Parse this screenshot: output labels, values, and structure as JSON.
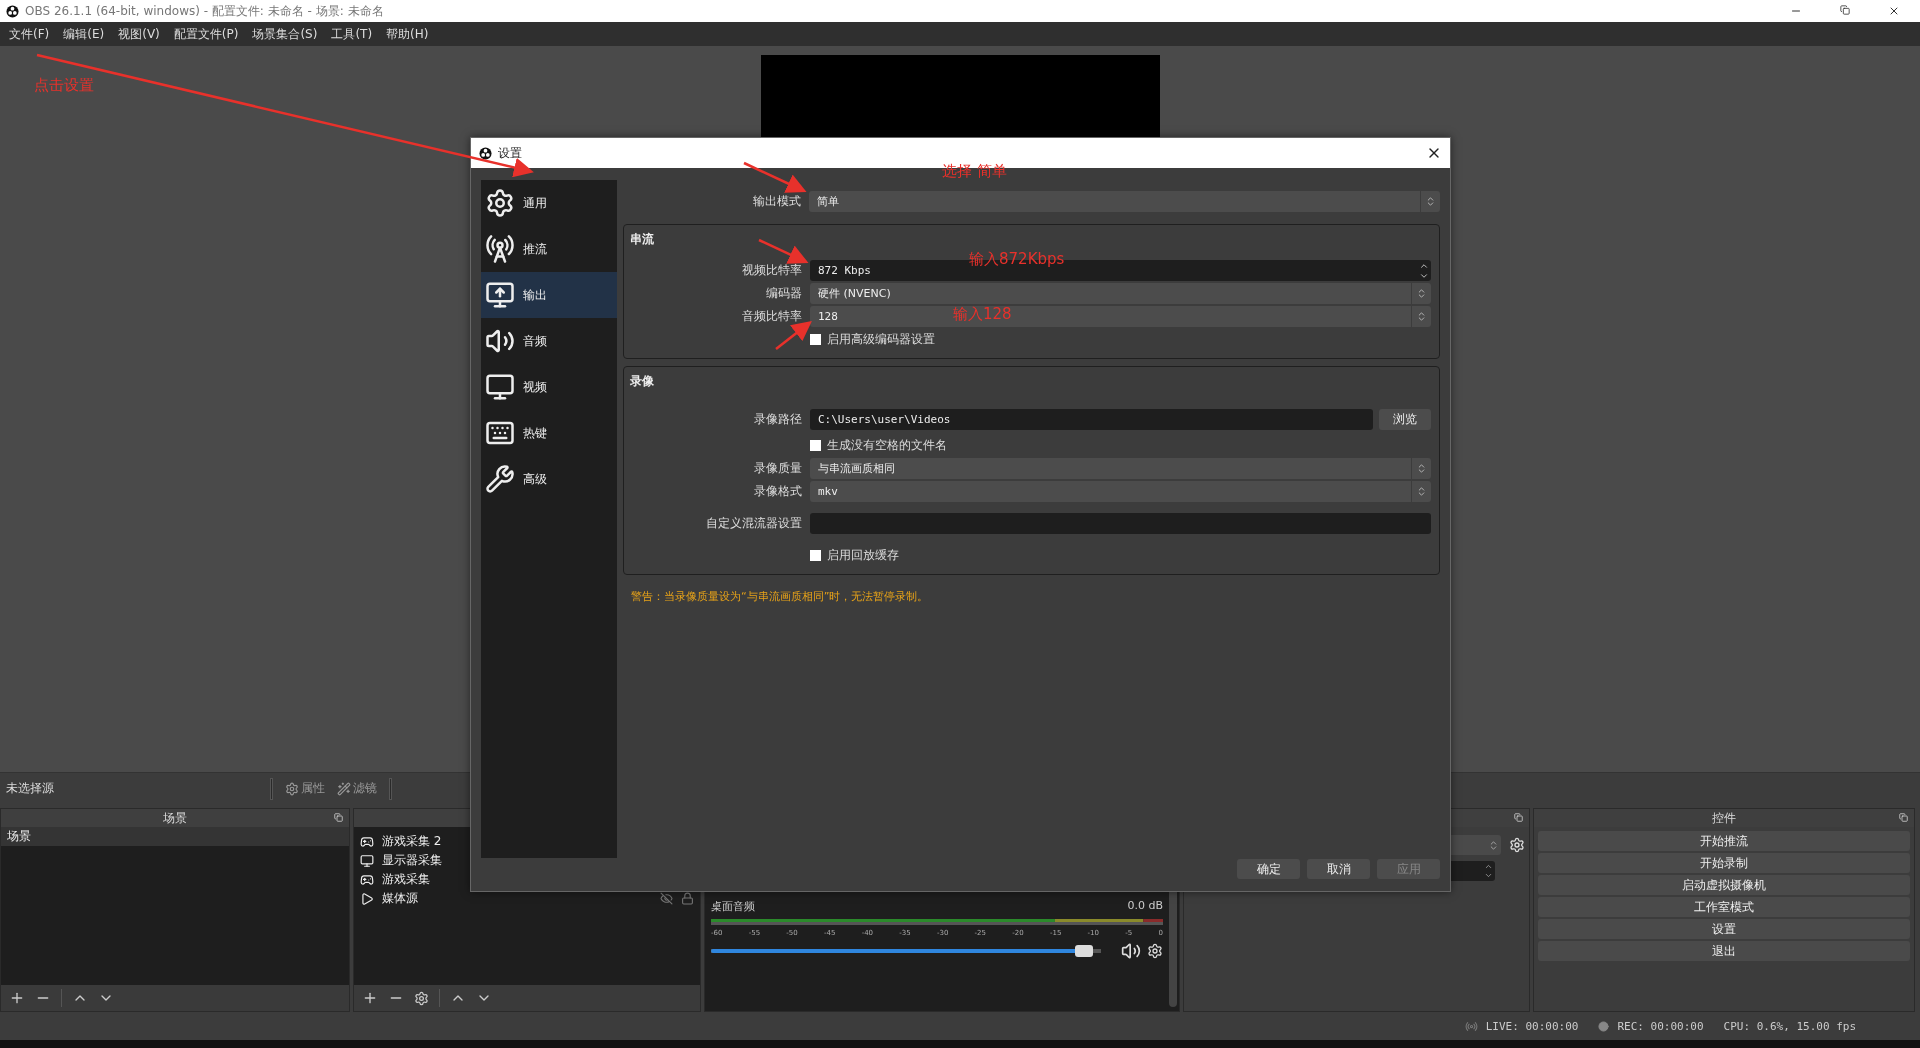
{
  "window": {
    "title": "OBS 26.1.1 (64-bit, windows) - 配置文件: 未命名 - 场景: 未命名"
  },
  "menu": [
    "文件(F)",
    "编辑(E)",
    "视图(V)",
    "配置文件(P)",
    "场景集合(S)",
    "工具(T)",
    "帮助(H)"
  ],
  "source_toolbar": {
    "label": "未选择源",
    "buttons": [
      "属性",
      "滤镜"
    ]
  },
  "scenes": {
    "title": "场景",
    "items": [
      {
        "label": "场景",
        "selected": true
      }
    ]
  },
  "sources": {
    "items": [
      {
        "label": "游戏采集 2",
        "kind": "game"
      },
      {
        "label": "显示器采集",
        "kind": "display"
      },
      {
        "label": "游戏采集",
        "kind": "game"
      },
      {
        "label": "媒体源",
        "kind": "media",
        "hovered": true
      }
    ]
  },
  "mixer": {
    "ticks": [
      "-60",
      "-55",
      "-50",
      "-45",
      "-40",
      "-35",
      "-30",
      "-25",
      "-20",
      "-15",
      "-10",
      "-5",
      "0"
    ],
    "channels": [
      {
        "name": "桌面音频",
        "reading": "0.0 dB",
        "level": 0.98,
        "muted": false
      }
    ]
  },
  "controls": {
    "title": "控件",
    "buttons": [
      "开始推流",
      "开始录制",
      "启动虚拟摄像机",
      "工作室模式",
      "设置",
      "退出"
    ]
  },
  "status_bar": {
    "live": "LIVE: 00:00:00",
    "rec": "REC: 00:00:00",
    "cpu": "CPU: 0.6%, 15.00 fps"
  },
  "settings_dialog": {
    "title": "设置",
    "sidebar": [
      {
        "label": "通用",
        "selected": false
      },
      {
        "label": "推流",
        "selected": false
      },
      {
        "label": "输出",
        "selected": true
      },
      {
        "label": "音频",
        "selected": false
      },
      {
        "label": "视频",
        "selected": false
      },
      {
        "label": "热键",
        "selected": false
      },
      {
        "label": "高级",
        "selected": false
      }
    ],
    "output_mode": {
      "label": "输出模式",
      "value": "简单"
    },
    "groups": [
      {
        "title": "串流",
        "fields": [
          {
            "kind": "spin",
            "label": "视频比特率",
            "value": "872 Kbps"
          },
          {
            "kind": "select",
            "label": "编码器",
            "value": "硬件 (NVENC)"
          },
          {
            "kind": "select",
            "label": "音频比特率",
            "value": "128"
          },
          {
            "kind": "checkbox",
            "label": "启用高级编码器设置",
            "checked": false
          }
        ]
      },
      {
        "title": "录像",
        "fields": [
          {
            "kind": "path",
            "label": "录像路径",
            "value": "C:\\Users\\user\\Videos",
            "button": "浏览"
          },
          {
            "kind": "checkbox",
            "label": "生成没有空格的文件名",
            "checked": false
          },
          {
            "kind": "select",
            "label": "录像质量",
            "value": "与串流画质相同"
          },
          {
            "kind": "select",
            "label": "录像格式",
            "value": "mkv"
          },
          {
            "kind": "text",
            "label": "自定义混流器设置"
          },
          {
            "kind": "checkbox",
            "label": "启用回放缓存",
            "checked": false
          }
        ]
      }
    ],
    "warning": "警告：当录像质量设为“与串流画质相同”时，无法暂停录制。",
    "buttons": [
      {
        "label": "确定",
        "disabled": false
      },
      {
        "label": "取消",
        "disabled": false
      },
      {
        "label": "应用",
        "disabled": true
      }
    ]
  },
  "annotations": [
    "点击设置",
    "选择 简单",
    "输入872Kbps",
    "输入128"
  ]
}
